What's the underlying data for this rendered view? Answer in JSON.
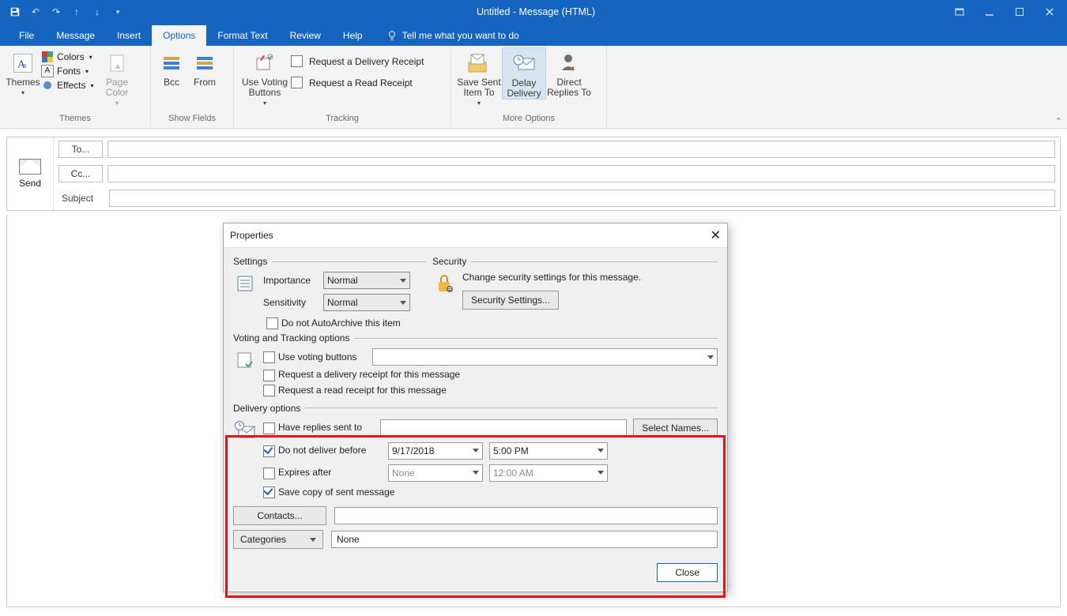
{
  "title": "Untitled  -  Message (HTML)",
  "tabs": {
    "file": "File",
    "message": "Message",
    "insert": "Insert",
    "options": "Options",
    "format": "Format Text",
    "review": "Review",
    "help": "Help",
    "tellme": "Tell me what you want to do"
  },
  "ribbon": {
    "themes": {
      "themes": "Themes",
      "colors": "Colors",
      "fonts": "Fonts",
      "effects": "Effects",
      "pagecolor": "Page\nColor",
      "group": "Themes"
    },
    "showfields": {
      "bcc": "Bcc",
      "from": "From",
      "group": "Show Fields"
    },
    "tracking": {
      "voting": "Use Voting\nButtons",
      "delivery": "Request a Delivery Receipt",
      "read": "Request a Read Receipt",
      "group": "Tracking"
    },
    "more": {
      "savesent": "Save Sent\nItem To",
      "delay": "Delay\nDelivery",
      "direct": "Direct\nReplies To",
      "group": "More Options"
    }
  },
  "compose": {
    "send": "Send",
    "to": "To...",
    "cc": "Cc...",
    "subject": "Subject"
  },
  "dialog": {
    "title": "Properties",
    "settings_legend": "Settings",
    "security_legend": "Security",
    "importance_label": "Importance",
    "importance_value": "Normal",
    "sensitivity_label": "Sensitivity",
    "sensitivity_value": "Normal",
    "noautoarchive": "Do not AutoArchive this item",
    "security_text": "Change security settings for this message.",
    "security_btn": "Security Settings...",
    "voting_legend": "Voting and Tracking options",
    "use_voting": "Use voting buttons",
    "req_delivery": "Request a delivery receipt for this message",
    "req_read": "Request a read receipt for this message",
    "delivery_legend": "Delivery options",
    "have_replies": "Have replies sent to",
    "select_names": "Select Names...",
    "dnd_before": "Do not deliver before",
    "dnd_date": "9/17/2018",
    "dnd_time": "5:00 PM",
    "expires": "Expires after",
    "exp_date": "None",
    "exp_time": "12:00 AM",
    "save_copy": "Save copy of sent message",
    "contacts": "Contacts...",
    "categories": "Categories",
    "cat_value": "None",
    "close": "Close"
  }
}
